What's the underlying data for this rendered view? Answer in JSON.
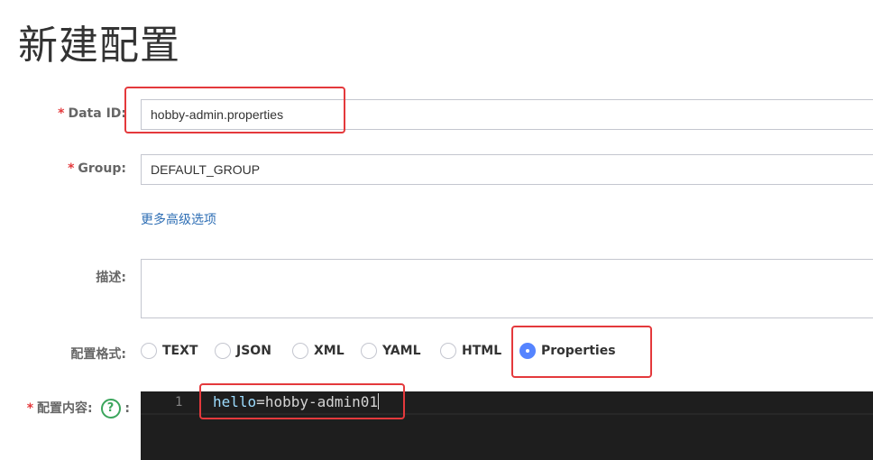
{
  "page": {
    "title": "新建配置"
  },
  "form": {
    "required_mark": "*",
    "data_id": {
      "label": "Data ID:",
      "value": "hobby-admin.properties"
    },
    "group": {
      "label": "Group:",
      "value": "DEFAULT_GROUP"
    },
    "advanced_link": "更多高级选项",
    "description": {
      "label": "描述:",
      "value": ""
    },
    "format": {
      "label": "配置格式:",
      "options": [
        "TEXT",
        "JSON",
        "XML",
        "YAML",
        "HTML",
        "Properties"
      ],
      "selected": "Properties"
    },
    "content": {
      "label": "配置内容:",
      "help_icon": "question-circle-icon",
      "help_glyph": "?",
      "colon": ":",
      "line_number": "1",
      "key": "hello",
      "equals": "=",
      "value": "hobby-admin01"
    }
  },
  "colors": {
    "required": "#e4393c",
    "link": "#2f6fb5",
    "radio_selected": "#5584ff",
    "editor_bg": "#1e1e1e",
    "highlight_box": "#e4393c"
  }
}
